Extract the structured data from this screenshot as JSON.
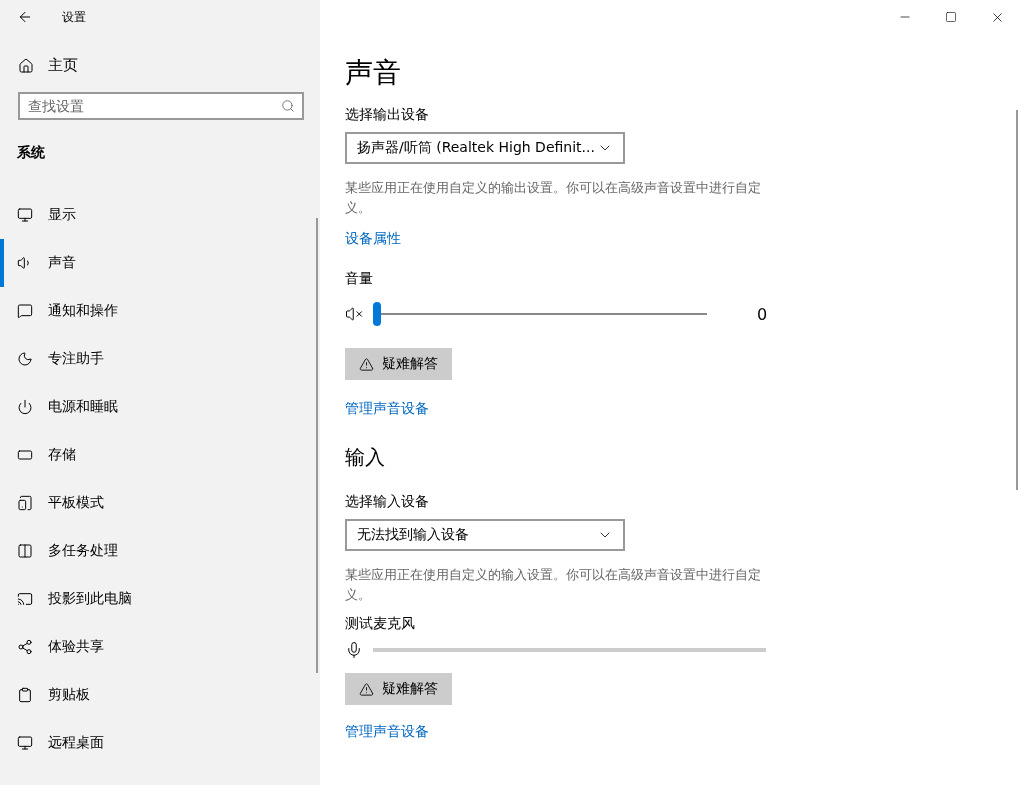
{
  "window": {
    "title": "设置"
  },
  "sidebar": {
    "home": "主页",
    "search": {
      "placeholder": "查找设置"
    },
    "section": "系统",
    "items": [
      {
        "kind": "display",
        "label": "显示",
        "selected": false
      },
      {
        "kind": "sound",
        "label": "声音",
        "selected": true
      },
      {
        "kind": "notify",
        "label": "通知和操作",
        "selected": false
      },
      {
        "kind": "focus",
        "label": "专注助手",
        "selected": false
      },
      {
        "kind": "power",
        "label": "电源和睡眠",
        "selected": false
      },
      {
        "kind": "storage",
        "label": "存储",
        "selected": false
      },
      {
        "kind": "tablet",
        "label": "平板模式",
        "selected": false
      },
      {
        "kind": "multitask",
        "label": "多任务处理",
        "selected": false
      },
      {
        "kind": "project",
        "label": "投影到此电脑",
        "selected": false
      },
      {
        "kind": "share",
        "label": "体验共享",
        "selected": false
      },
      {
        "kind": "clipboard",
        "label": "剪贴板",
        "selected": false
      },
      {
        "kind": "remote",
        "label": "远程桌面",
        "selected": false
      }
    ]
  },
  "content": {
    "title": "声音",
    "output": {
      "label": "选择输出设备",
      "device": "扬声器/听筒 (Realtek High Definit...",
      "note": "某些应用正在使用自定义的输出设置。你可以在高级声音设置中进行自定义。",
      "link": "设备属性",
      "volume_label": "音量",
      "volume": {
        "level": 0,
        "reading": "0"
      },
      "troubleshoot": "疑难解答",
      "manage": "管理声音设备"
    },
    "input": {
      "heading": "输入",
      "label": "选择输入设备",
      "device": "无法找到输入设备",
      "note": "某些应用正在使用自定义的输入设置。你可以在高级声音设置中进行自定义。",
      "test_label": "测试麦克风",
      "troubleshoot": "疑难解答",
      "manage": "管理声音设备"
    }
  }
}
